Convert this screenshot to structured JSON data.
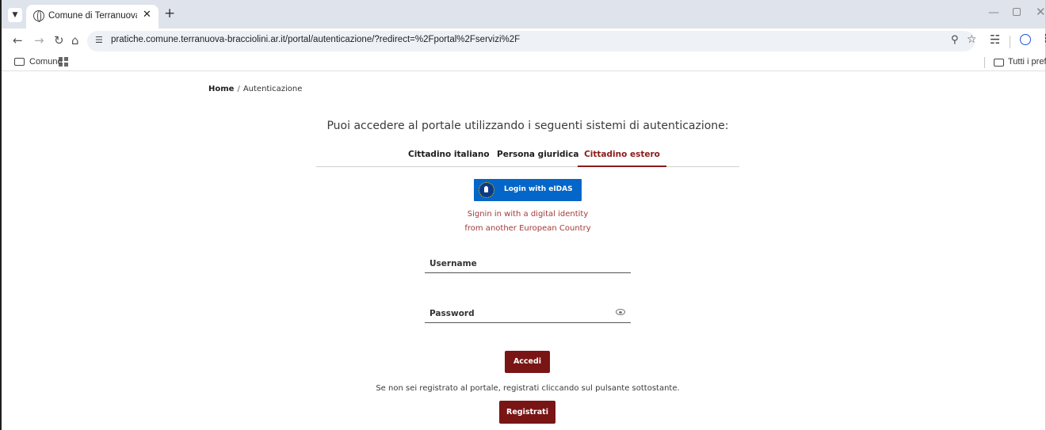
{
  "browser": {
    "tab_title": "Comune di Terranuova Bracciolini",
    "url": "pratiche.comune.terranuova-bracciolini.ar.it/portal/autenticazione/?redirect=%2Fportal%2Fservizi%2F",
    "bookmarks": {
      "folder_label": "Comune",
      "all_bookmarks_label": "Tutti i preferiti"
    }
  },
  "breadcrumb": {
    "home": "Home",
    "separator": "/",
    "current": "Autenticazione"
  },
  "heading": "Puoi accedere al portale utilizzando i seguenti sistemi di autenticazione:",
  "auth_tabs": [
    {
      "label": "Cittadino italiano",
      "active": false
    },
    {
      "label": "Persona giuridica",
      "active": false
    },
    {
      "label": "Cittadino estero",
      "active": true
    }
  ],
  "eidas": {
    "button_label": "Login with eIDAS",
    "note_line1": "Signin in with a digital identity",
    "note_line2": "from another European Country"
  },
  "form": {
    "username_placeholder": "Username",
    "password_placeholder": "Password",
    "submit_label": "Accedi"
  },
  "register": {
    "note": "Se non sei registrato al portale, registrati cliccando sul pulsante sottostante.",
    "button_label": "Registrati"
  },
  "colors": {
    "brand": "#7a1515",
    "active_tab": "#8b1a1a",
    "eidas_blue": "#0466c8"
  }
}
